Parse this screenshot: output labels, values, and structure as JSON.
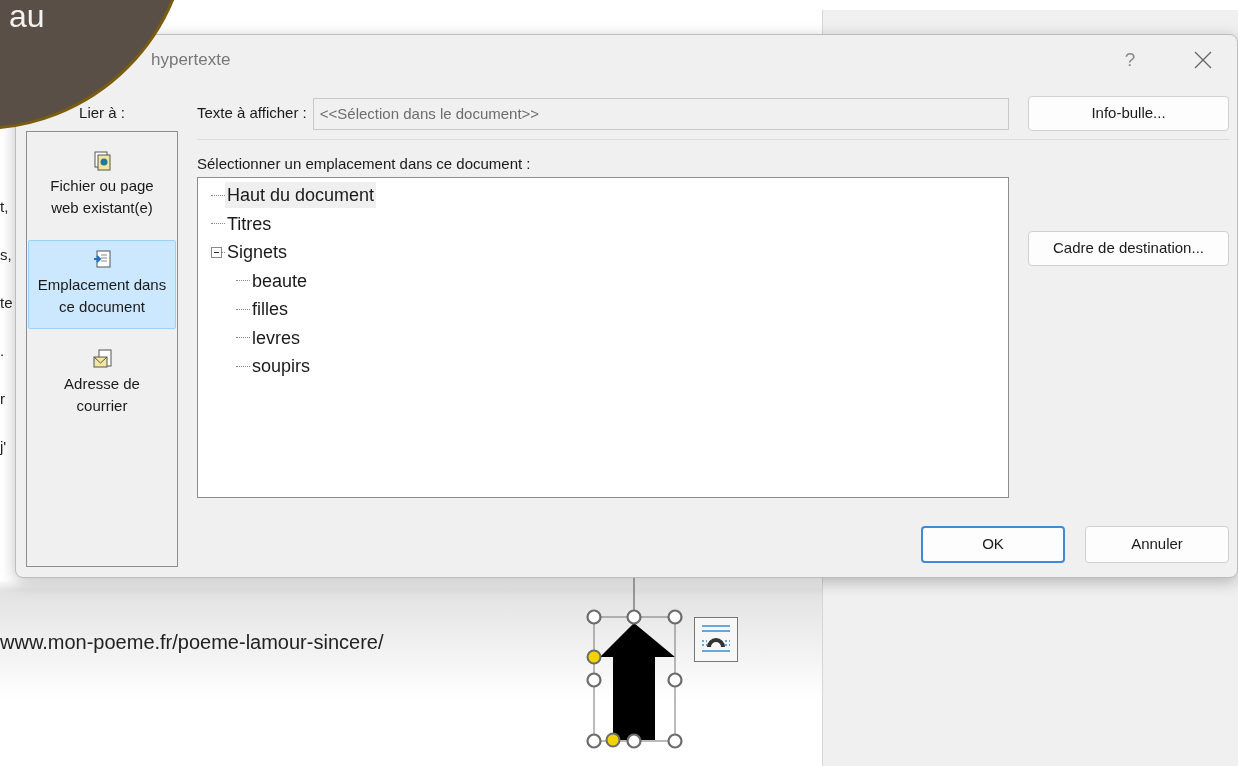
{
  "overlay": {
    "text": "au"
  },
  "document": {
    "fragments": [
      "t,",
      "s,",
      "te",
      ".",
      "r",
      "j'"
    ],
    "link": "www.mon-poeme.fr/poeme-lamour-sincere/"
  },
  "dialog": {
    "title": "hypertexte",
    "help": "?",
    "link_to": {
      "label": "Lier à :",
      "items": [
        {
          "label": "Fichier ou page\nweb existant(e)",
          "kind": "file",
          "selected": false
        },
        {
          "label": "Emplacement dans\nce document",
          "kind": "place",
          "selected": true
        },
        {
          "label": "Adresse de\ncourrier",
          "kind": "mail",
          "selected": false
        }
      ]
    },
    "display_text": {
      "label": "Texte à afficher :",
      "value": "<<Sélection dans le document>>",
      "disabled": true
    },
    "tooltip_button": "Info-bulle...",
    "location_label": "Sélectionner un emplacement dans ce document :",
    "tree": [
      {
        "label": "Haut du document",
        "selected": true
      },
      {
        "label": "Titres",
        "selected": false
      },
      {
        "label": "Signets",
        "selected": false,
        "expanded": true,
        "children": [
          {
            "label": "beaute",
            "selected": false
          },
          {
            "label": "filles",
            "selected": false
          },
          {
            "label": "levres",
            "selected": false
          },
          {
            "label": "soupirs",
            "selected": false
          }
        ]
      }
    ],
    "frame_button": "Cadre de destination...",
    "buttons": [
      {
        "label": "OK",
        "default": true
      },
      {
        "label": "Annuler",
        "default": false
      }
    ]
  }
}
